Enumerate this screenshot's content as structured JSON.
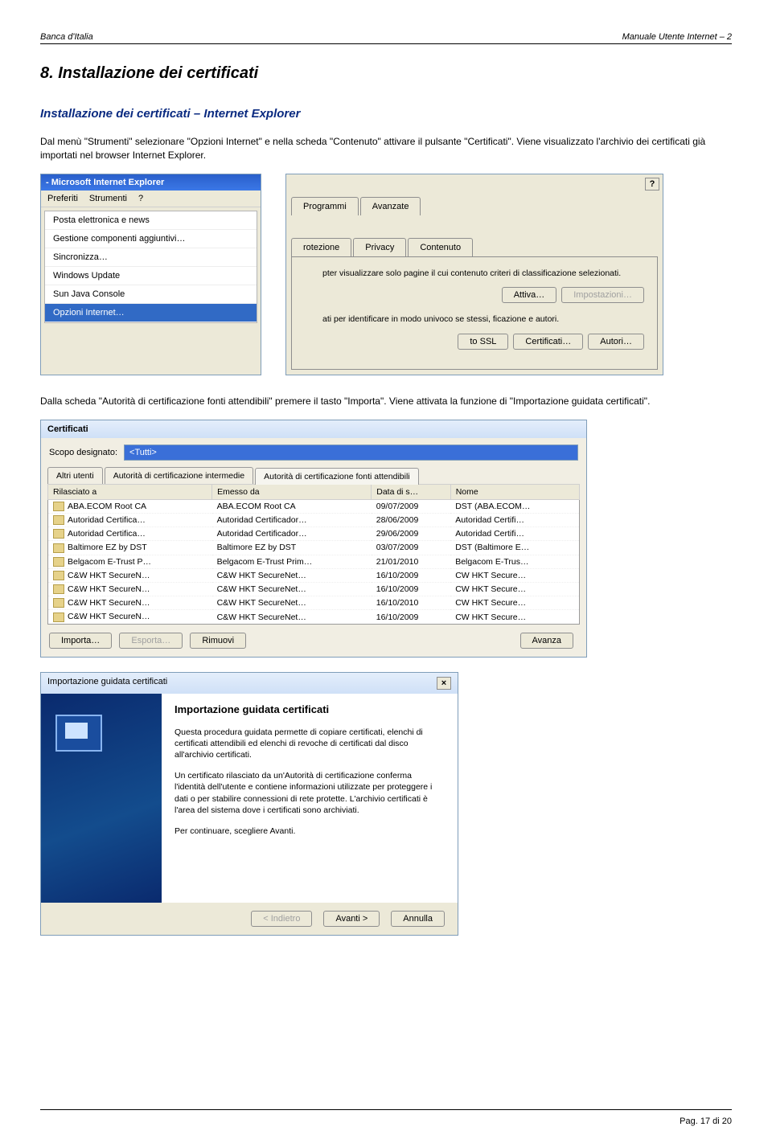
{
  "header": {
    "left": "Banca d'Italia",
    "right": "Manuale Utente Internet – 2"
  },
  "h1": "8.  Installazione dei certificati",
  "h2": "Installazione dei certificati – Internet Explorer",
  "para1_a": "Dal menù \"Strumenti\" selezionare \"Opzioni Internet\" e nella scheda \"Contenuto\" attivare il pulsante \"Certificati\". Viene visualizzato l'archivio dei certificati già importati nel browser Internet Explorer.",
  "para2": "Dalla scheda \"Autorità di certificazione fonti attendibili\" premere il tasto \"Importa\". Viene attivata la funzione di \"Importazione guidata certificati\".",
  "iebar": {
    "title": "- Microsoft Internet Explorer",
    "menu": [
      "Preferiti",
      "Strumenti",
      "?"
    ],
    "dropdown": [
      "Posta elettronica e news",
      "Gestione componenti aggiuntivi…",
      "Sincronizza…",
      "Windows Update",
      "Sun Java Console",
      "Opzioni Internet…"
    ]
  },
  "opt": {
    "help": "?",
    "tabs_row1": [
      "Programmi",
      "Avanzate"
    ],
    "tabs_row2": [
      "rotezione",
      "Privacy",
      "Contenuto"
    ],
    "txt1": "pter visualizzare solo pagine il cui contenuto criteri di classificazione selezionati.",
    "btn_attiva": "Attiva…",
    "btn_impost": "Impostazioni…",
    "txt2": "ati per identificare in modo univoco se stessi, ficazione e autori.",
    "btn_ssl": "to SSL",
    "btn_cert": "Certificati…",
    "btn_aut": "Autori…"
  },
  "certwin": {
    "title": "Certificati",
    "scope_label": "Scopo designato:",
    "scope_value": "<Tutti>",
    "tabs": [
      "Altri utenti",
      "Autorità di certificazione intermedie",
      "Autorità di certificazione fonti attendibili"
    ],
    "columns": [
      "Rilasciato a",
      "Emesso da",
      "Data di s…",
      "Nome"
    ],
    "rows": [
      [
        "ABA.ECOM Root CA",
        "ABA.ECOM Root CA",
        "09/07/2009",
        "DST (ABA.ECOM…"
      ],
      [
        "Autoridad Certifica…",
        "Autoridad Certificador…",
        "28/06/2009",
        "Autoridad Certifi…"
      ],
      [
        "Autoridad Certifica…",
        "Autoridad Certificador…",
        "29/06/2009",
        "Autoridad Certifi…"
      ],
      [
        "Baltimore EZ by DST",
        "Baltimore EZ by DST",
        "03/07/2009",
        "DST (Baltimore E…"
      ],
      [
        "Belgacom E-Trust P…",
        "Belgacom E-Trust Prim…",
        "21/01/2010",
        "Belgacom E-Trus…"
      ],
      [
        "C&W HKT SecureN…",
        "C&W HKT SecureNet…",
        "16/10/2009",
        "CW HKT Secure…"
      ],
      [
        "C&W HKT SecureN…",
        "C&W HKT SecureNet…",
        "16/10/2009",
        "CW HKT Secure…"
      ],
      [
        "C&W HKT SecureN…",
        "C&W HKT SecureNet…",
        "16/10/2010",
        "CW HKT Secure…"
      ],
      [
        "C&W HKT SecureN…",
        "C&W HKT SecureNet…",
        "16/10/2009",
        "CW HKT Secure…"
      ]
    ],
    "btn_import": "Importa…",
    "btn_export": "Esporta…",
    "btn_remove": "Rimuovi",
    "btn_adv": "Avanza"
  },
  "wiz": {
    "bar": "Importazione guidata certificati",
    "close": "×",
    "heading": "Importazione guidata certificati",
    "p1": "Questa procedura guidata permette di copiare certificati, elenchi di certificati attendibili ed elenchi di revoche di certificati dal disco all'archivio certificati.",
    "p2": "Un certificato rilasciato da un'Autorità di certificazione conferma l'identità dell'utente e contiene informazioni utilizzate per proteggere i dati o per stabilire connessioni di rete protette. L'archivio certificati è l'area del sistema dove i certificati sono archiviati.",
    "p3": "Per continuare, scegliere Avanti.",
    "btn_back": "< Indietro",
    "btn_next": "Avanti >",
    "btn_cancel": "Annulla"
  },
  "footer": "Pag. 17 di 20"
}
